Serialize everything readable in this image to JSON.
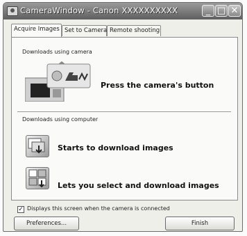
{
  "window": {
    "title": "CameraWindow - Canon XXXXXXXXXX"
  },
  "tabs": [
    {
      "label": "Acquire Images",
      "active": true
    },
    {
      "label": "Set to Camera",
      "active": false
    },
    {
      "label": "Remote shooting",
      "active": false
    }
  ],
  "camera_section": {
    "label": "Downloads using camera",
    "instruction": "Press the camera's button"
  },
  "computer_section": {
    "label": "Downloads using computer",
    "actions": [
      {
        "label": "Starts to download images",
        "icon": "download-all-icon"
      },
      {
        "label": "Lets you select and download images",
        "icon": "select-download-icon"
      }
    ]
  },
  "footer": {
    "checkbox_label": "Displays this screen when the camera is connected",
    "checkbox_checked": true,
    "preferences_label": "Preferences...",
    "finish_label": "Finish"
  },
  "title_buttons": {
    "minimize": "_",
    "maximize": "□",
    "close": "✕"
  }
}
